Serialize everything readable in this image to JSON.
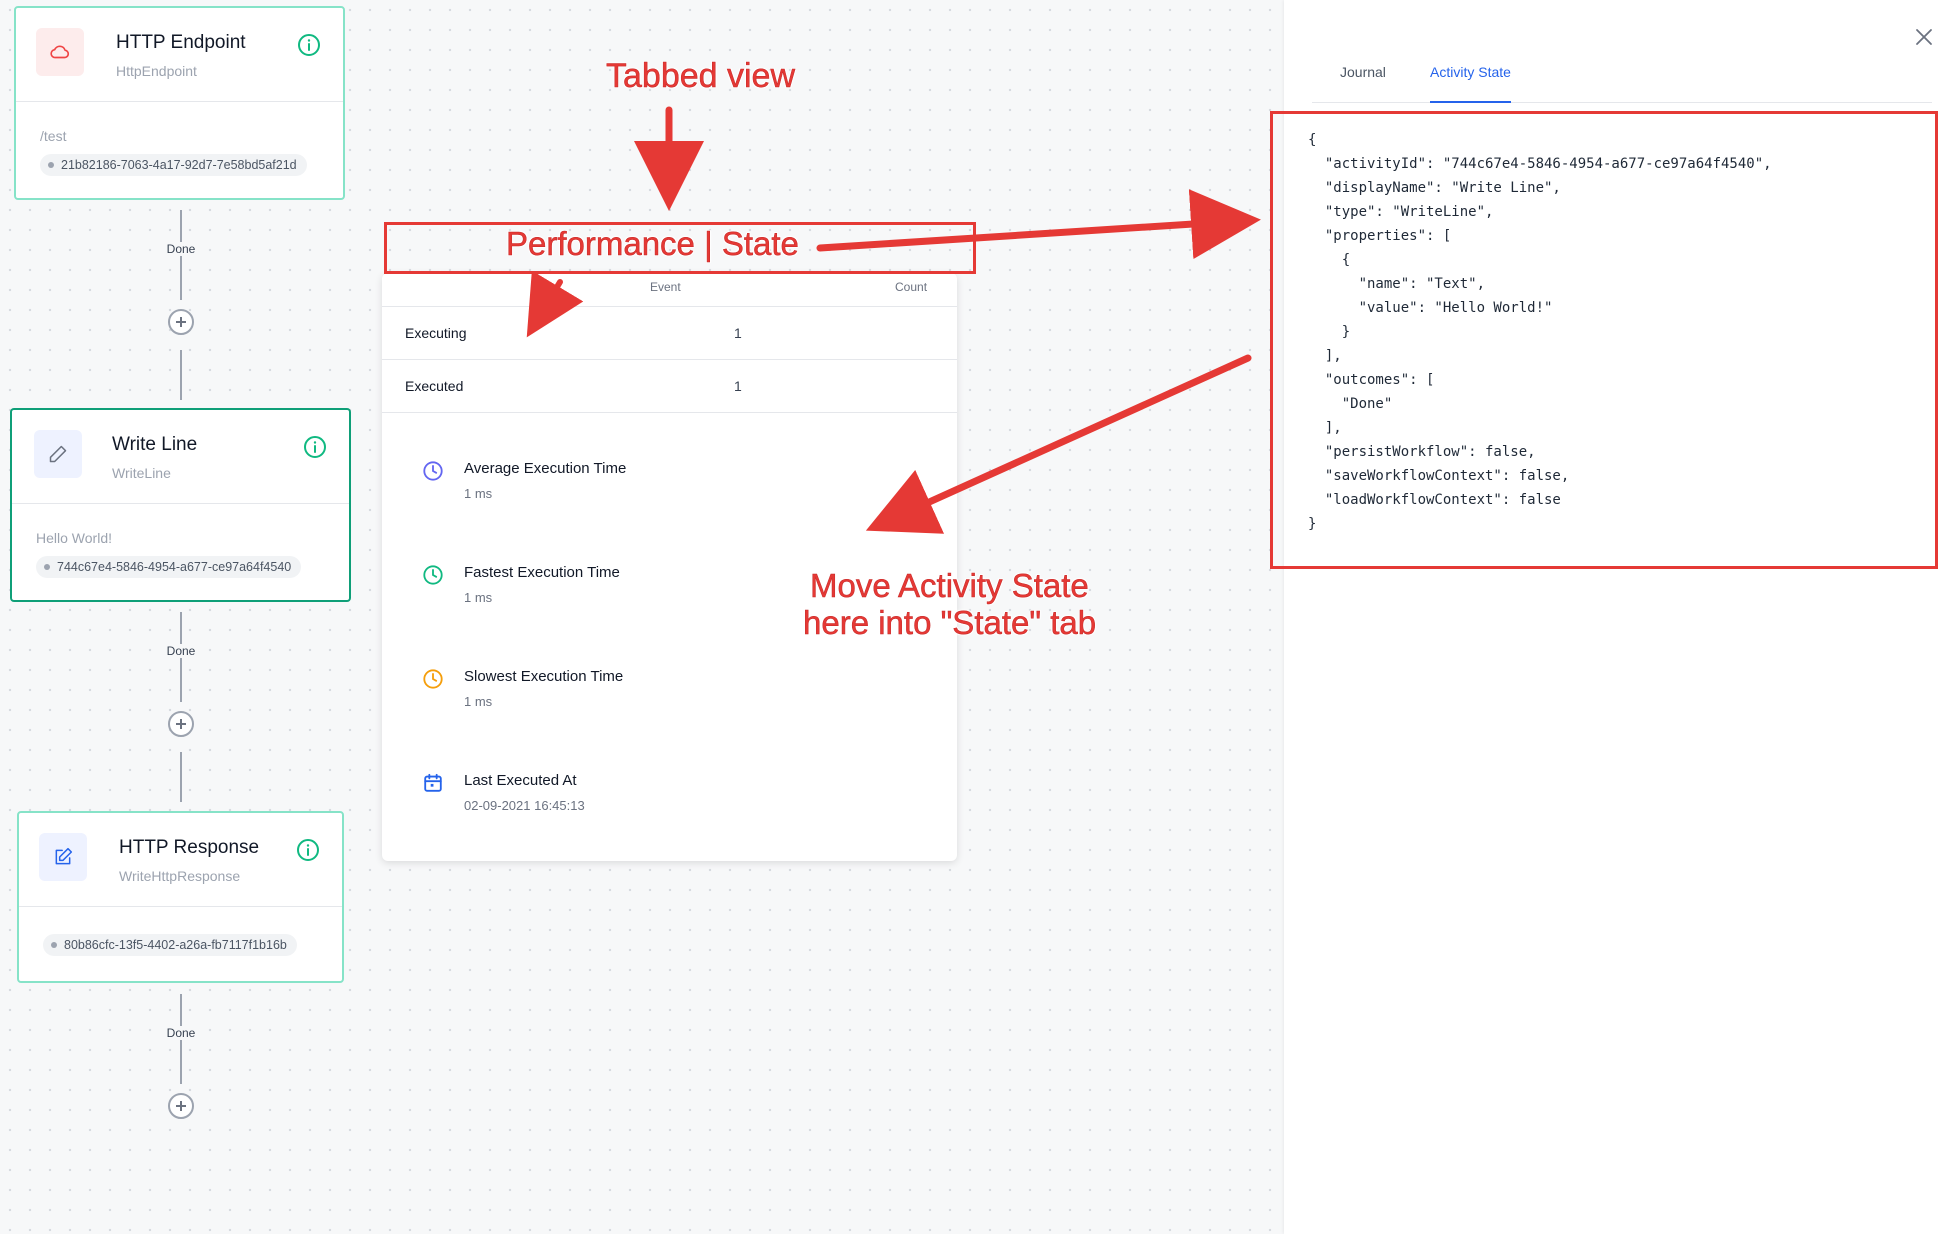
{
  "nodes": {
    "http_endpoint": {
      "title": "HTTP Endpoint",
      "subtitle": "HttpEndpoint",
      "text": "/test",
      "id": "21b82186-7063-4a17-92d7-7e58bd5af21d",
      "icon": "cloud-icon"
    },
    "write_line": {
      "title": "Write Line",
      "subtitle": "WriteLine",
      "text": "Hello World!",
      "id": "744c67e4-5846-4954-a677-ce97a64f4540",
      "icon": "pencil-icon"
    },
    "http_response": {
      "title": "HTTP Response",
      "subtitle": "WriteHttpResponse",
      "text": "",
      "id": "80b86cfc-13f5-4402-a26a-fb7117f1b16b",
      "icon": "edit-icon"
    }
  },
  "outcomes": {
    "done1": "Done",
    "done2": "Done",
    "done3": "Done"
  },
  "performance": {
    "headers": {
      "event": "Event",
      "count": "Count"
    },
    "rows": [
      {
        "event": "Executing",
        "count": "1"
      },
      {
        "event": "Executed",
        "count": "1"
      }
    ],
    "stats": [
      {
        "label": "Average Execution Time",
        "value": "1 ms",
        "icon": "clock-icon",
        "color": "#6366f1"
      },
      {
        "label": "Fastest Execution Time",
        "value": "1 ms",
        "icon": "clock-icon",
        "color": "#10b981"
      },
      {
        "label": "Slowest Execution Time",
        "value": "1 ms",
        "icon": "clock-icon",
        "color": "#f59e0b"
      },
      {
        "label": "Last Executed At",
        "value": "02-09-2021 16:45:13",
        "icon": "calendar-icon",
        "color": "#2563eb"
      }
    ]
  },
  "panel": {
    "tabs": {
      "journal": "Journal",
      "activity_state": "Activity State"
    },
    "active_tab": "Activity State",
    "state_json": "{\n  \"activityId\": \"744c67e4-5846-4954-a677-ce97a64f4540\",\n  \"displayName\": \"Write Line\",\n  \"type\": \"WriteLine\",\n  \"properties\": [\n    {\n      \"name\": \"Text\",\n      \"value\": \"Hello World!\"\n    }\n  ],\n  \"outcomes\": [\n    \"Done\"\n  ],\n  \"persistWorkflow\": false,\n  \"saveWorkflowContext\": false,\n  \"loadWorkflowContext\": false\n}"
  },
  "annotations": {
    "tabbed_view": "Tabbed view",
    "performance_state": "Performance | State",
    "move_line1": "Move Activity State",
    "move_line2": "here into \"State\" tab"
  },
  "colors": {
    "accent": "#2563eb",
    "node_border": "#86e3c8",
    "node_selected_border": "#0f9f78",
    "annotation_red": "#e53935"
  }
}
